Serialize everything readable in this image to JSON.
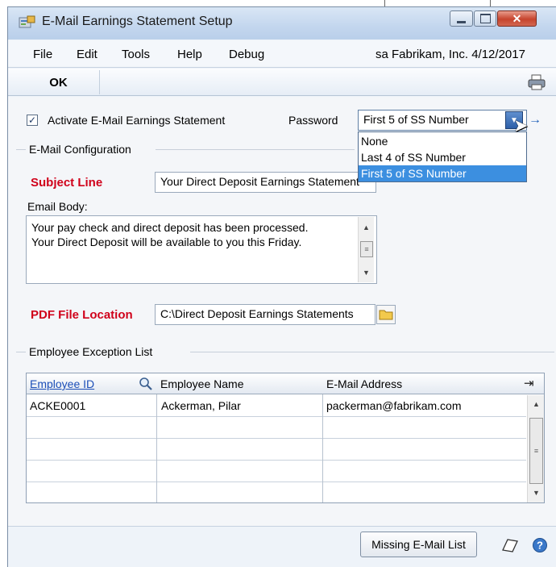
{
  "window": {
    "title": "E-Mail Earnings Statement Setup"
  },
  "menu": {
    "items": [
      "File",
      "Edit",
      "Tools",
      "Help",
      "Debug"
    ],
    "context": "sa  Fabrikam, Inc.  4/12/2017"
  },
  "toolbar": {
    "ok_label": "OK"
  },
  "activate": {
    "label": "Activate E-Mail Earnings Statement",
    "checked": true
  },
  "password": {
    "label": "Password",
    "selected": "First 5 of SS Number",
    "options": [
      "None",
      "Last 4 of SS Number",
      "First 5 of SS Number"
    ],
    "highlighted_option": "First 5 of SS Number"
  },
  "email_config": {
    "group_label": "E-Mail Configuration",
    "subject_label": "Subject Line",
    "subject_value": "Your Direct Deposit Earnings Statement",
    "body_label": "Email Body:",
    "body_line1": "Your pay check and direct deposit has been processed.",
    "body_line2": "Your Direct Deposit will be available to you this Friday."
  },
  "pdf": {
    "label": "PDF File Location",
    "value": "C:\\Direct Deposit Earnings Statements"
  },
  "exceptions": {
    "group_label": "Employee Exception List",
    "columns": [
      "Employee ID",
      "Employee Name",
      "E-Mail Address"
    ],
    "rows": [
      {
        "id": "ACKE0001",
        "name": "Ackerman, Pilar",
        "email": "packerman@fabrikam.com"
      }
    ]
  },
  "bottom": {
    "missing_label": "Missing E-Mail List"
  },
  "colors": {
    "required_label": "#d0021b",
    "selection": "#3c8fe0",
    "link": "#1d4fb8"
  }
}
